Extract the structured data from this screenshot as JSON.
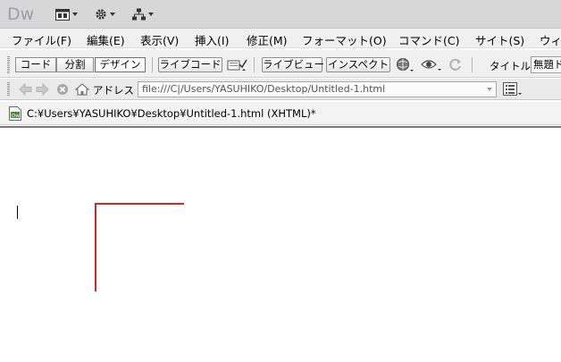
{
  "app": {
    "logo": "Dw",
    "layout_button_icon": "layout-grid-icon",
    "settings_button_icon": "gear-icon",
    "site_button_icon": "site-tree-icon"
  },
  "menu": {
    "items": [
      {
        "label": "ファイル(F)"
      },
      {
        "label": "編集(E)"
      },
      {
        "label": "表示(V)"
      },
      {
        "label": "挿入(I)"
      },
      {
        "label": "修正(M)"
      },
      {
        "label": "フォーマット(O)"
      },
      {
        "label": "コマンド(C)"
      },
      {
        "label": "サイト(S)"
      },
      {
        "label": "ウィ"
      }
    ]
  },
  "toolbar": {
    "code_label": "コード",
    "split_label": "分割",
    "design_label": "デザイン",
    "live_code_label": "ライブコード",
    "live_view_label": "ライブビュー",
    "inspect_label": "インスペクト",
    "title_label": "タイトル :",
    "title_value": "無題ド"
  },
  "nav": {
    "address_label": "アドレス :",
    "address_value": "file:///C|/Users/YASUHIKO/Desktop/Untitled-1.html"
  },
  "document": {
    "path": "C:¥Users¥YASUHIKO¥Desktop¥Untitled-1.html (XHTML)*",
    "file_icon": "dw-file-icon"
  },
  "colors": {
    "accent_red": "#cc2a2a",
    "app_bar": "#d7d7d7"
  }
}
